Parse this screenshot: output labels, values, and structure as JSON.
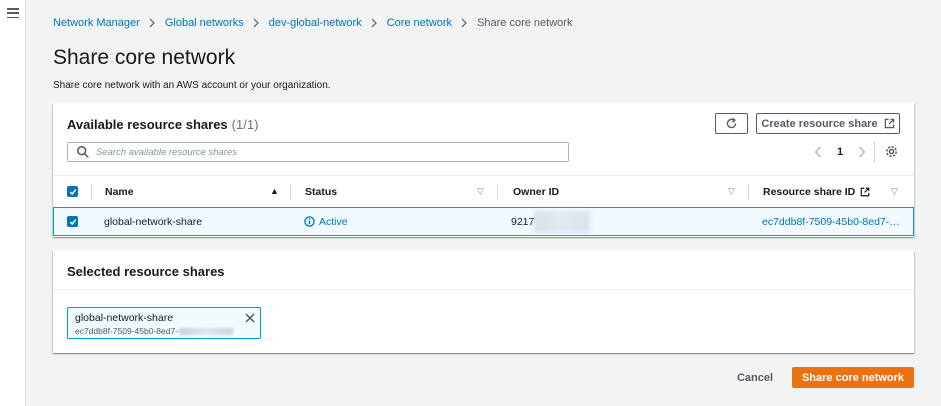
{
  "breadcrumb": {
    "items": [
      "Network Manager",
      "Global networks",
      "dev-global-network",
      "Core network"
    ],
    "current": "Share core network"
  },
  "page": {
    "title": "Share core network",
    "description": "Share core network with an AWS account or your organization."
  },
  "available": {
    "title": "Available resource shares",
    "count": "(1/1)",
    "create_label": "Create resource share",
    "search_placeholder": "Search available resource shares",
    "page": "1",
    "columns": [
      "Name",
      "Status",
      "Owner ID",
      "Resource share ID"
    ],
    "rows": [
      {
        "name": "global-network-share",
        "status": "Active",
        "owner_id": "9217",
        "share_id": "ec7ddb8f-7509-45b0-8ed7-…"
      }
    ]
  },
  "selected": {
    "title": "Selected resource shares",
    "token_name": "global-network-share",
    "token_id": "ec7ddb8f-7509-45b0-8ed7-"
  },
  "footer": {
    "cancel": "Cancel",
    "submit": "Share core network"
  },
  "colors": {
    "link": "#0073bb",
    "primary": "#ec7211",
    "selected_bg": "#f1faff",
    "selected_border": "#00a1c9",
    "success": "#1d8102"
  }
}
